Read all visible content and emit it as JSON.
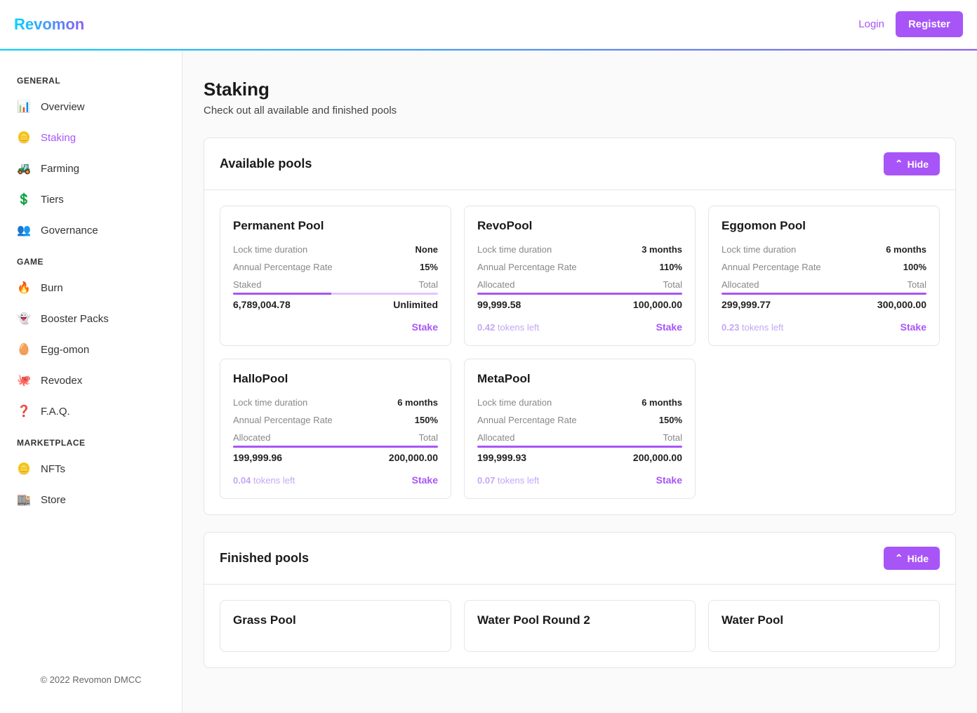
{
  "header": {
    "logo": "Revomon",
    "login": "Login",
    "register": "Register"
  },
  "sidebar": {
    "sections": [
      {
        "title": "GENERAL",
        "items": [
          {
            "label": "Overview",
            "icon": "📊",
            "active": false
          },
          {
            "label": "Staking",
            "icon": "🪙",
            "active": true
          },
          {
            "label": "Farming",
            "icon": "🚜",
            "active": false
          },
          {
            "label": "Tiers",
            "icon": "💲",
            "active": false
          },
          {
            "label": "Governance",
            "icon": "👥",
            "active": false
          }
        ]
      },
      {
        "title": "GAME",
        "items": [
          {
            "label": "Burn",
            "icon": "🔥",
            "active": false
          },
          {
            "label": "Booster Packs",
            "icon": "👻",
            "active": false
          },
          {
            "label": "Egg-omon",
            "icon": "🥚",
            "active": false
          },
          {
            "label": "Revodex",
            "icon": "🐙",
            "active": false
          },
          {
            "label": "F.A.Q.",
            "icon": "❓",
            "active": false
          }
        ]
      },
      {
        "title": "MARKETPLACE",
        "items": [
          {
            "label": "NFTs",
            "icon": "🪙",
            "active": false
          },
          {
            "label": "Store",
            "icon": "🏬",
            "active": false
          }
        ]
      }
    ],
    "footer": "© 2022 Revomon DMCC"
  },
  "page": {
    "title": "Staking",
    "subtitle": "Check out all available and finished pools"
  },
  "labels": {
    "lockTime": "Lock time duration",
    "apr": "Annual Percentage Rate",
    "staked": "Staked",
    "allocated": "Allocated",
    "total": "Total",
    "tokensLeft": "tokens left",
    "stake": "Stake",
    "hide": "Hide"
  },
  "availableSection": {
    "title": "Available pools",
    "pools": [
      {
        "name": "Permanent Pool",
        "lockTime": "None",
        "apr": "15%",
        "leftLabel": "Staked",
        "leftValue": "6,789,004.78",
        "rightValue": "Unlimited",
        "progress": 48,
        "tokensLeft": null
      },
      {
        "name": "RevoPool",
        "lockTime": "3 months",
        "apr": "110%",
        "leftLabel": "Allocated",
        "leftValue": "99,999.58",
        "rightValue": "100,000.00",
        "progress": 100,
        "tokensLeft": "0.42"
      },
      {
        "name": "Eggomon Pool",
        "lockTime": "6 months",
        "apr": "100%",
        "leftLabel": "Allocated",
        "leftValue": "299,999.77",
        "rightValue": "300,000.00",
        "progress": 100,
        "tokensLeft": "0.23"
      },
      {
        "name": "HalloPool",
        "lockTime": "6 months",
        "apr": "150%",
        "leftLabel": "Allocated",
        "leftValue": "199,999.96",
        "rightValue": "200,000.00",
        "progress": 100,
        "tokensLeft": "0.04"
      },
      {
        "name": "MetaPool",
        "lockTime": "6 months",
        "apr": "150%",
        "leftLabel": "Allocated",
        "leftValue": "199,999.93",
        "rightValue": "200,000.00",
        "progress": 100,
        "tokensLeft": "0.07"
      }
    ]
  },
  "finishedSection": {
    "title": "Finished pools",
    "pools": [
      {
        "name": "Grass Pool"
      },
      {
        "name": "Water Pool Round 2"
      },
      {
        "name": "Water Pool"
      }
    ]
  }
}
